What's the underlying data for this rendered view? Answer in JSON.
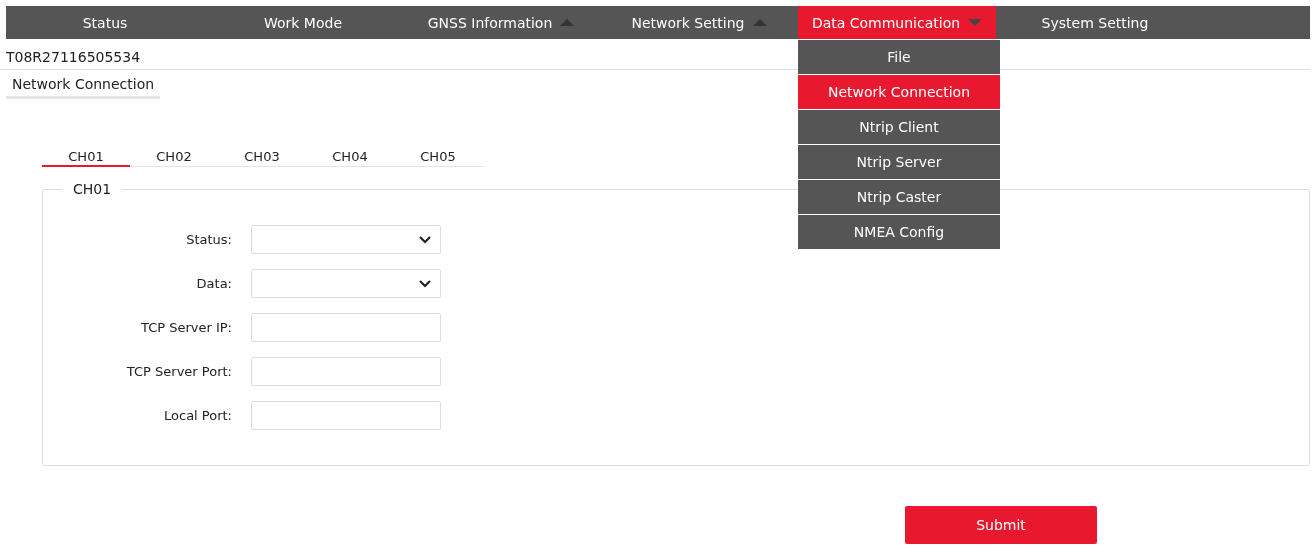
{
  "nav": [
    {
      "label": "Status",
      "selected": false
    },
    {
      "label": "Work Mode",
      "selected": false
    },
    {
      "label": "GNSS Information",
      "selected": false,
      "expanded": false
    },
    {
      "label": "Network Setting",
      "selected": false,
      "expanded": false
    },
    {
      "label": "Data Communication",
      "selected": true,
      "expanded": true
    },
    {
      "label": "System Setting",
      "selected": false
    }
  ],
  "dropdown": [
    {
      "label": "File",
      "selected": false
    },
    {
      "label": "Network Connection",
      "selected": true
    },
    {
      "label": "Ntrip Client",
      "selected": false
    },
    {
      "label": "Ntrip Server",
      "selected": false
    },
    {
      "label": "Ntrip Caster",
      "selected": false
    },
    {
      "label": "NMEA Config",
      "selected": false
    }
  ],
  "serial": "T08R27116505534",
  "page_title": "Network Connection",
  "channel_tabs": [
    {
      "label": "CH01",
      "selected": true
    },
    {
      "label": "CH02",
      "selected": false
    },
    {
      "label": "CH03",
      "selected": false
    },
    {
      "label": "CH04",
      "selected": false
    },
    {
      "label": "CH05",
      "selected": false
    }
  ],
  "group_title": "CH01",
  "fields": [
    {
      "label": "Status:",
      "kind": "select"
    },
    {
      "label": "Data:",
      "kind": "select"
    },
    {
      "label": "TCP Server IP:",
      "kind": "text"
    },
    {
      "label": "TCP Server Port:",
      "kind": "text"
    },
    {
      "label": "Local Port:",
      "kind": "text"
    }
  ],
  "submit": "Submit"
}
